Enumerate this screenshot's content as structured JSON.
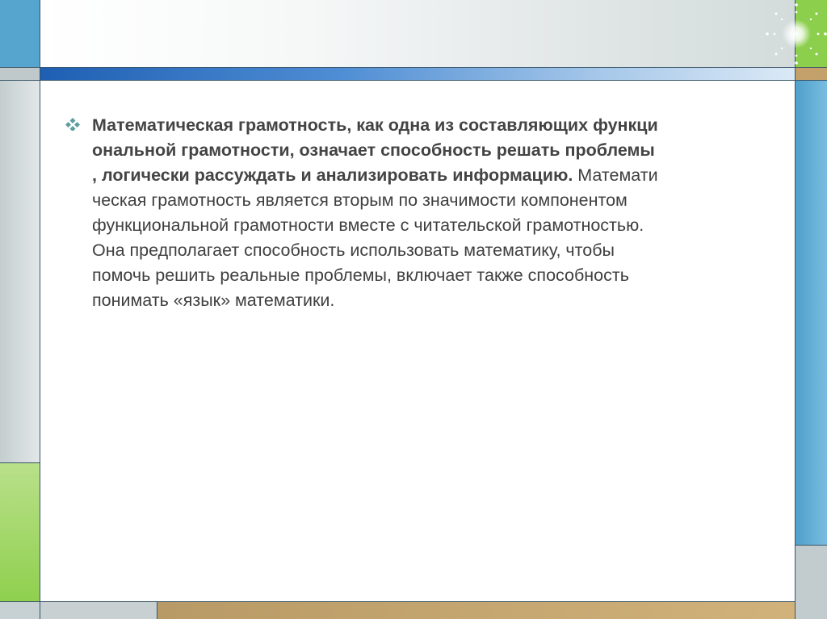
{
  "slide": {
    "bullet": {
      "icon": "diamond-bullet-icon",
      "bold_text": "Математическая грамотность, как одна из составляющих функци\nональной грамотности, означает способность решать проблемы\n, логически рассуждать и анализировать информацию.",
      "regular_text": " Математи\nческая грамотность является вторым по значимости компонентом\nфункциональной грамотности вместе с читательской грамотностью.\nОна предполагает способность использовать математику, чтобы\nпомочь решить реальные проблемы, включает также способность\nпонимать «язык» математики."
    }
  },
  "theme": {
    "blue": "#55a5cf",
    "green": "#8ccf4d",
    "tan": "#c4a06a",
    "gray": "#c4cecf",
    "bullet_color": "#5f9ea0",
    "text_color": "#3f3f3f"
  },
  "decor": {
    "sparkle": "sparkle-star-icon"
  }
}
